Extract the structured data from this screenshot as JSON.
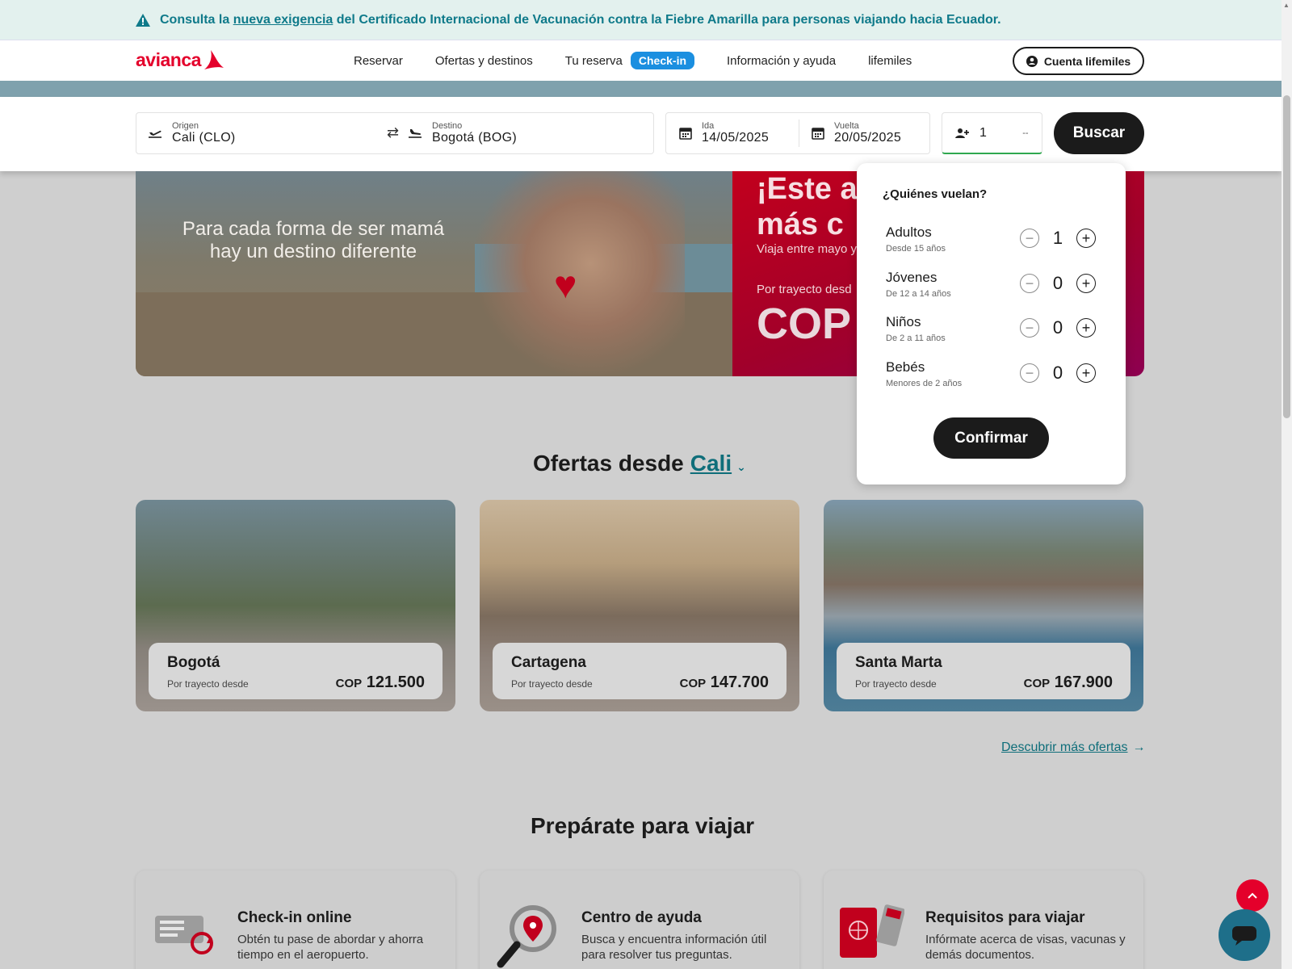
{
  "alert": {
    "text_before": "Consulta la ",
    "link": "nueva exigencia",
    "text_after": " del Certificado Internacional de Vacunación contra la Fiebre Amarilla para personas viajando hacia Ecuador."
  },
  "header": {
    "logo": "avianca",
    "nav": {
      "reservar": "Reservar",
      "ofertas": "Ofertas y destinos",
      "tu_reserva": "Tu reserva",
      "checkin_badge": "Check-in",
      "info": "Información y ayuda",
      "lifemiles": "lifemiles"
    },
    "account_button": "Cuenta lifemiles"
  },
  "search": {
    "origin_label": "Origen",
    "origin_value": "Cali  (CLO)",
    "dest_label": "Destino",
    "dest_value": "Bogotá  (BOG)",
    "ida_label": "Ida",
    "ida_value": "14/05/2025",
    "vuelta_label": "Vuelta",
    "vuelta_value": "20/05/2025",
    "pax_value": "1",
    "pax_trailing": "--",
    "button": "Buscar"
  },
  "banner": {
    "tagline": "Para cada forma de ser mamá hay un destino diferente",
    "promo_headline_1": "¡Este añ",
    "promo_headline_2": "más c",
    "promo_sub": "Viaja entre mayo y",
    "promo_from": "Por trayecto desd",
    "promo_price": "COP"
  },
  "passengers": {
    "title": "¿Quiénes vuelan?",
    "rows": [
      {
        "label": "Adultos",
        "sub": "Desde 15 años",
        "count": "1"
      },
      {
        "label": "Jóvenes",
        "sub": "De 12 a 14 años",
        "count": "0"
      },
      {
        "label": "Niños",
        "sub": "De 2 a 11 años",
        "count": "0"
      },
      {
        "label": "Bebés",
        "sub": "Menores de 2 años",
        "count": "0"
      }
    ],
    "confirm": "Confirmar"
  },
  "offers": {
    "title": "Ofertas desde",
    "city": "Cali",
    "cards": [
      {
        "city": "Bogotá",
        "desde": "Por trayecto desde",
        "currency": "COP",
        "amount": "121.500"
      },
      {
        "city": "Cartagena",
        "desde": "Por trayecto desde",
        "currency": "COP",
        "amount": "147.700"
      },
      {
        "city": "Santa Marta",
        "desde": "Por trayecto desde",
        "currency": "COP",
        "amount": "167.900"
      }
    ],
    "more_link": "Descubrir más ofertas"
  },
  "prepare": {
    "title": "Prepárate para viajar",
    "cards": [
      {
        "title": "Check-in online",
        "desc": "Obtén tu pase de abordar y ahorra tiempo en el aeropuerto."
      },
      {
        "title": "Centro de ayuda",
        "desc": "Busca y encuentra información útil para resolver tus preguntas."
      },
      {
        "title": "Requisitos para viajar",
        "desc": "Infórmate acerca de visas, vacunas y demás documentos."
      }
    ]
  },
  "colors": {
    "brand_red": "#e4002b",
    "dark": "#1b1b1b",
    "teal": "#0f6e7a",
    "badge_blue": "#1b8fe0"
  }
}
